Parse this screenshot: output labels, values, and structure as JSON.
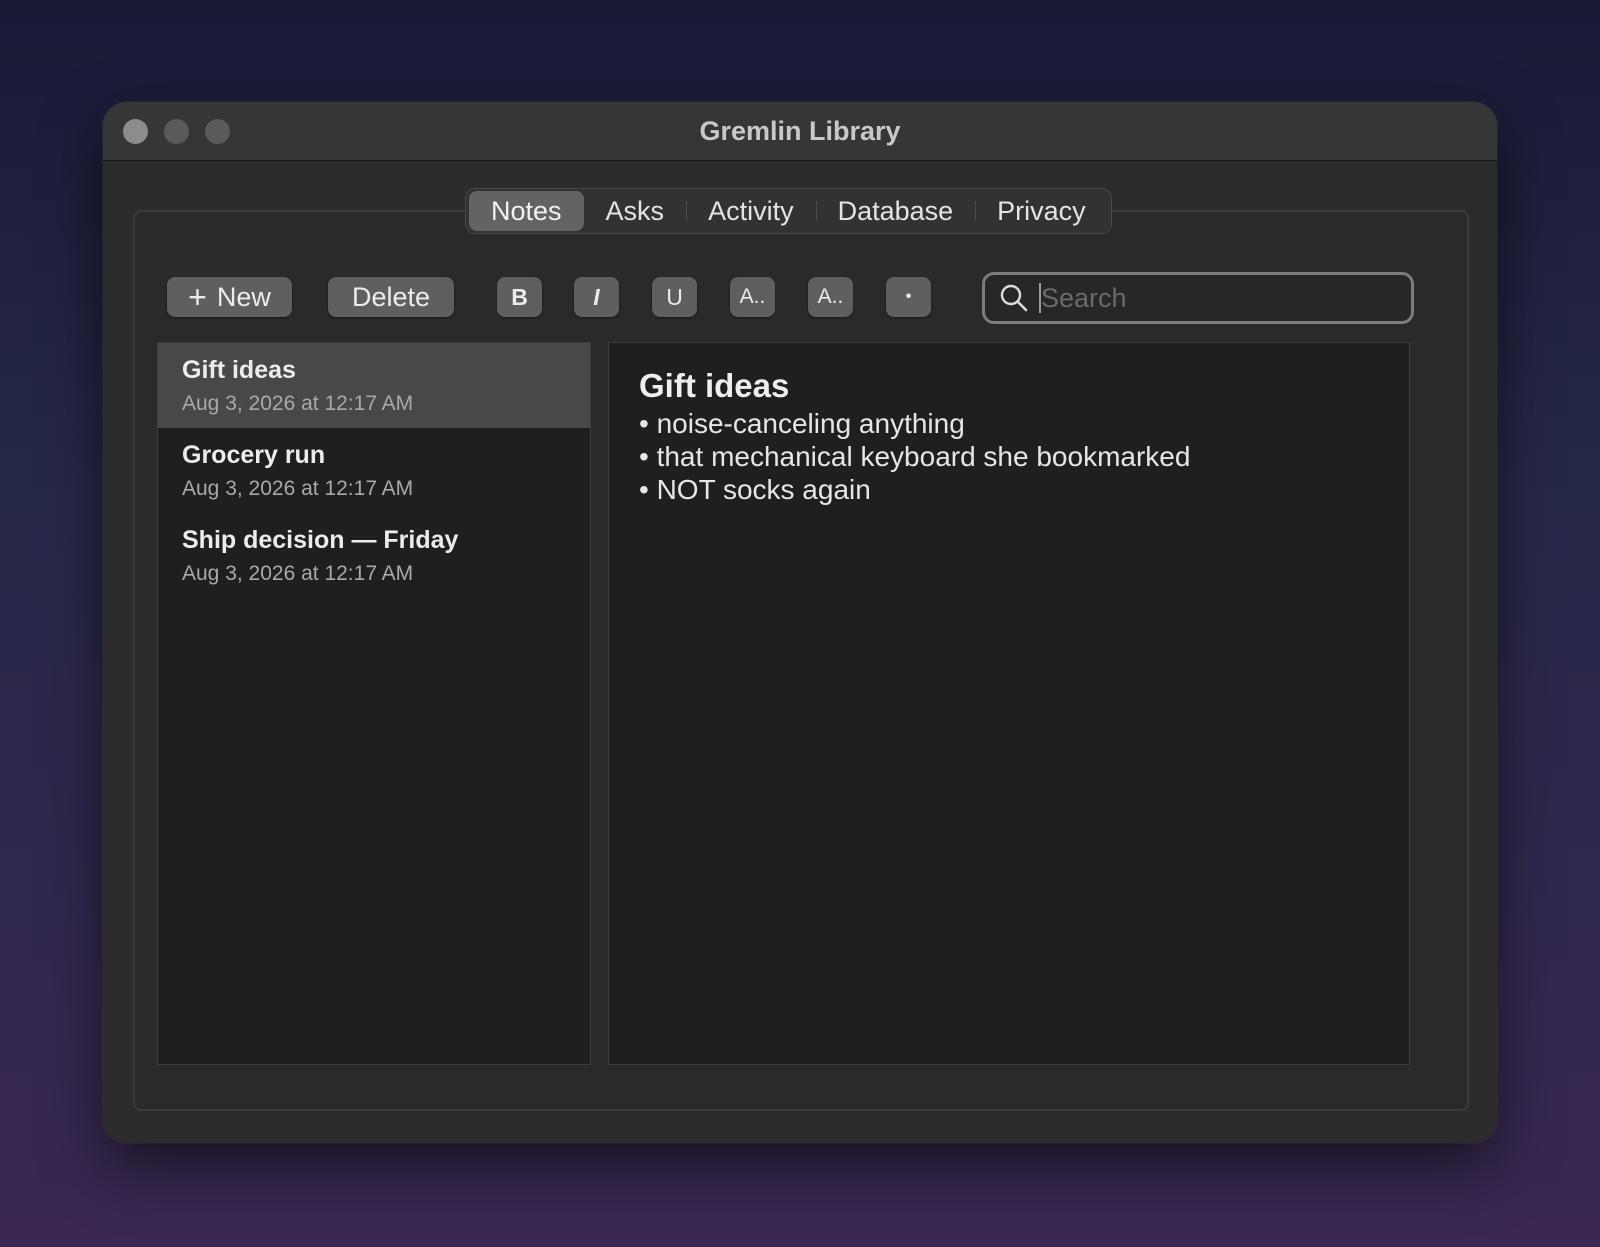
{
  "window": {
    "title": "Gremlin Library"
  },
  "tabs": [
    {
      "label": "Notes",
      "active": true
    },
    {
      "label": "Asks",
      "active": false
    },
    {
      "label": "Activity",
      "active": false
    },
    {
      "label": "Database",
      "active": false
    },
    {
      "label": "Privacy",
      "active": false
    }
  ],
  "toolbar": {
    "new_plus": "+",
    "new_label": "New",
    "delete_label": "Delete",
    "bold_label": "B",
    "italic_label": "I",
    "underline_label": "U",
    "font_label": "A..",
    "color_label": "A..",
    "bullet_label": "•"
  },
  "search": {
    "placeholder": "Search",
    "value": ""
  },
  "notes": [
    {
      "title": "Gift ideas",
      "date": "Aug 3, 2026 at 12:17 AM",
      "selected": true
    },
    {
      "title": "Grocery run",
      "date": "Aug 3, 2026 at 12:17 AM",
      "selected": false
    },
    {
      "title": "Ship decision — Friday",
      "date": "Aug 3, 2026 at 12:17 AM",
      "selected": false
    }
  ],
  "editor": {
    "title": "Gift ideas",
    "lines": [
      "• noise-canceling anything",
      "• that mechanical keyboard she bookmarked",
      "• NOT socks again"
    ]
  }
}
